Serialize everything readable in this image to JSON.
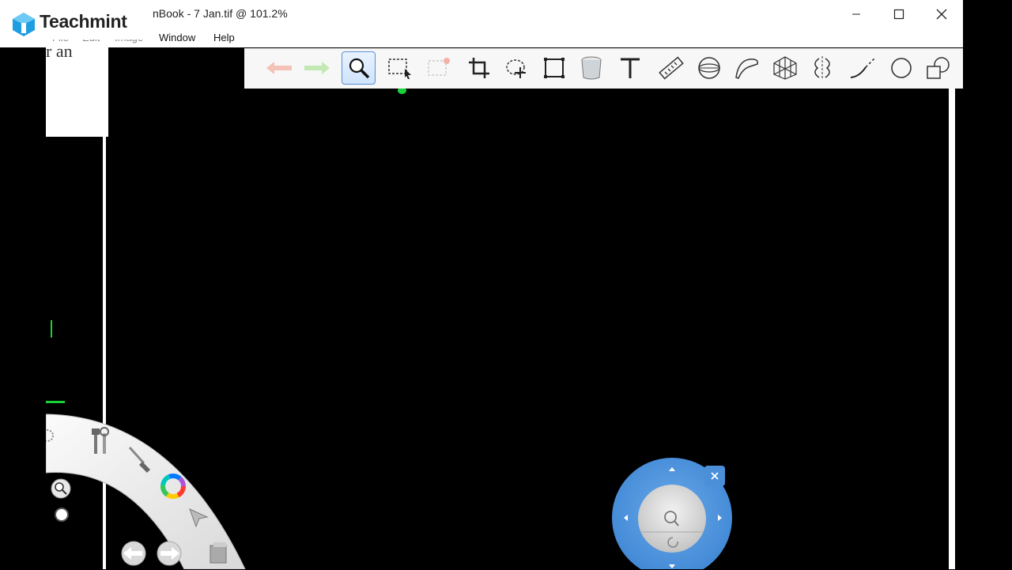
{
  "window": {
    "title": "nBook - 7 Jan.tif @ 101.2%",
    "menu": [
      "File",
      "Edit",
      "Image",
      "Window",
      "Help"
    ],
    "controls": [
      "minimize",
      "maximize",
      "close"
    ]
  },
  "logo": {
    "text": "Teachmint"
  },
  "toolbar": {
    "tools": [
      {
        "name": "undo-icon",
        "active": false
      },
      {
        "name": "redo-icon",
        "active": false
      },
      {
        "name": "magnifier-icon",
        "active": true
      },
      {
        "name": "rect-select-icon",
        "active": false
      },
      {
        "name": "clear-selection-icon",
        "active": false
      },
      {
        "name": "crop-icon",
        "active": false
      },
      {
        "name": "lasso-move-icon",
        "active": false
      },
      {
        "name": "transform-icon",
        "active": false
      },
      {
        "name": "fill-bucket-icon",
        "active": false
      },
      {
        "name": "text-icon",
        "active": false
      },
      {
        "name": "ruler-icon",
        "active": false
      },
      {
        "name": "ellipse-guide-icon",
        "active": false
      },
      {
        "name": "french-curve-icon",
        "active": false
      },
      {
        "name": "perspective-grid-icon",
        "active": false
      },
      {
        "name": "symmetry-icon",
        "active": false
      },
      {
        "name": "stroke-icon",
        "active": false
      },
      {
        "name": "ellipse-icon",
        "active": false
      },
      {
        "name": "shapes-icon",
        "active": false
      }
    ]
  },
  "canvas": {
    "partial_text_top": "r an",
    "background": "#000000"
  },
  "colors": {
    "accent": "#4a8fd8",
    "toolbar_bg": "#f7f7f7",
    "green_stroke": "#19d23a"
  }
}
